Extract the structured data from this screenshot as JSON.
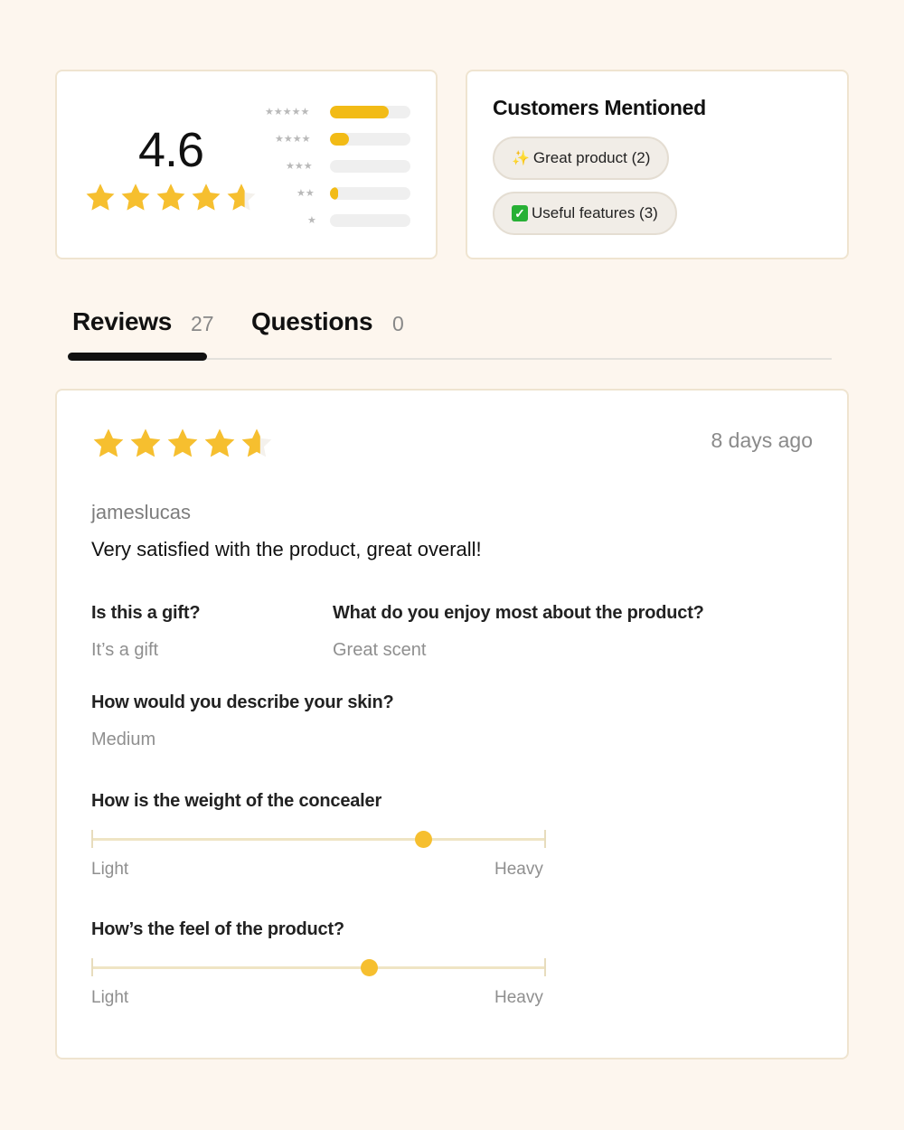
{
  "summary": {
    "average": "4.6",
    "rating_value": 4.6,
    "distribution": [
      {
        "stars": 5,
        "label": "★★★★★",
        "fraction": 0.73
      },
      {
        "stars": 4,
        "label": "★★★★",
        "fraction": 0.24
      },
      {
        "stars": 3,
        "label": "★★★",
        "fraction": 0.0
      },
      {
        "stars": 2,
        "label": "★★",
        "fraction": 0.1
      },
      {
        "stars": 1,
        "label": "★",
        "fraction": 0.0
      }
    ],
    "star_color": "#f6bf2f",
    "bar_color": "#f2bb16"
  },
  "mentions": {
    "title": "Customers Mentioned",
    "items": [
      {
        "icon": "sparkles-icon",
        "glyph": "✨",
        "label": "Great product (2)"
      },
      {
        "icon": "check-icon",
        "glyph": "✓",
        "label": "Useful features (3)"
      }
    ]
  },
  "tabs": [
    {
      "label": "Reviews",
      "count": "27",
      "active": true
    },
    {
      "label": "Questions",
      "count": "0",
      "active": false
    }
  ],
  "review": {
    "rating": 4.6,
    "date": "8 days ago",
    "author": "jameslucas",
    "text": "Very satisfied with the product, great overall!",
    "qa": [
      {
        "question": "Is this a gift?",
        "answer": "It’s a gift"
      },
      {
        "question": "What do you enjoy most about the product?",
        "answer": "Great scent"
      },
      {
        "question": "How would you describe your skin?",
        "answer": "Medium"
      }
    ],
    "sliders": [
      {
        "question": "How is the weight of the concealer",
        "min_label": "Light",
        "max_label": "Heavy",
        "value": 0.73
      },
      {
        "question": "How’s the feel of the product?",
        "min_label": "Light",
        "max_label": "Heavy",
        "value": 0.61
      }
    ]
  }
}
